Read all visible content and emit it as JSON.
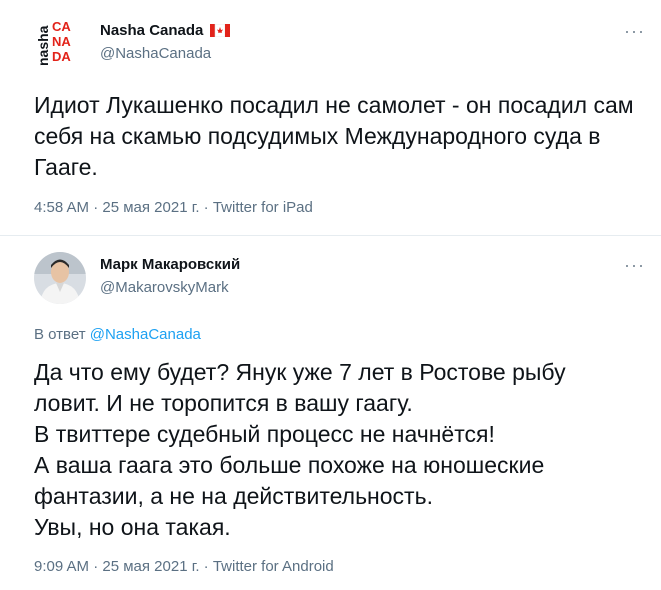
{
  "tweet1": {
    "logo_text_left": "nasha",
    "logo_text_right": "CANADA",
    "display_name": "Nasha Canada",
    "handle": "@NashaCanada",
    "text": "Идиот Лукашенко посадил не самолет - он посадил сам себя на скамью подсудимых Международного суда в Гааге.",
    "meta": "4:58 AM · 25 мая 2021 г. · Twitter for iPad"
  },
  "tweet2": {
    "display_name": "Марк Макаровский",
    "handle": "@MakarovskyMark",
    "reply_prefix": "В ответ ",
    "reply_to": "@NashaCanada",
    "lines": [
      "Да что ему будет? Янук уже 7 лет в Ростове рыбу",
      "ловит. И не торопится в вашу гаагу.",
      "В твиттере судебный процесс не начнётся!",
      "А ваша гаага это больше похоже на юношеские",
      "фантазии, а не на действительность.",
      "Увы, но она такая."
    ],
    "meta": "9:09 AM · 25 мая 2021 г. · Twitter for Android"
  },
  "more_label": "···",
  "colors": {
    "accent": "#1da1f2",
    "secondary": "#5b7083",
    "logo_red": "#e2231a"
  }
}
